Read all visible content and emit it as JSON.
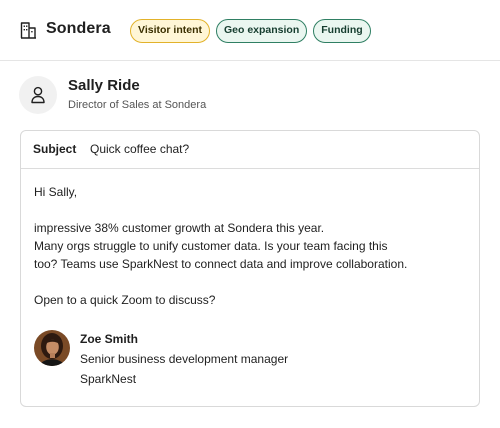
{
  "header": {
    "company_name": "Sondera",
    "company_icon": "building-icon",
    "tags": [
      "Visitor intent",
      "Geo expansion",
      "Funding"
    ],
    "tag_colors": {
      "yellow": "#e2b22a",
      "green": "#2f7f63"
    }
  },
  "contact": {
    "avatar_icon": "user-icon",
    "name": "Sally Ride",
    "title": "Director of Sales at Sondera"
  },
  "email": {
    "subject_label": "Subject",
    "subject": "Quick coffee chat?",
    "greeting": "Hi Sally,",
    "body_lines": [
      "impressive 38% customer growth at Sondera this year.",
      "Many orgs struggle to unify customer data. Is your team facing this",
      "too? Teams use SparkNest to connect data and improve collaboration."
    ],
    "closing": "Open to a quick Zoom to discuss?",
    "signature": {
      "name": "Zoe Smith",
      "role": "Senior business development manager",
      "company": "SparkNest"
    }
  }
}
